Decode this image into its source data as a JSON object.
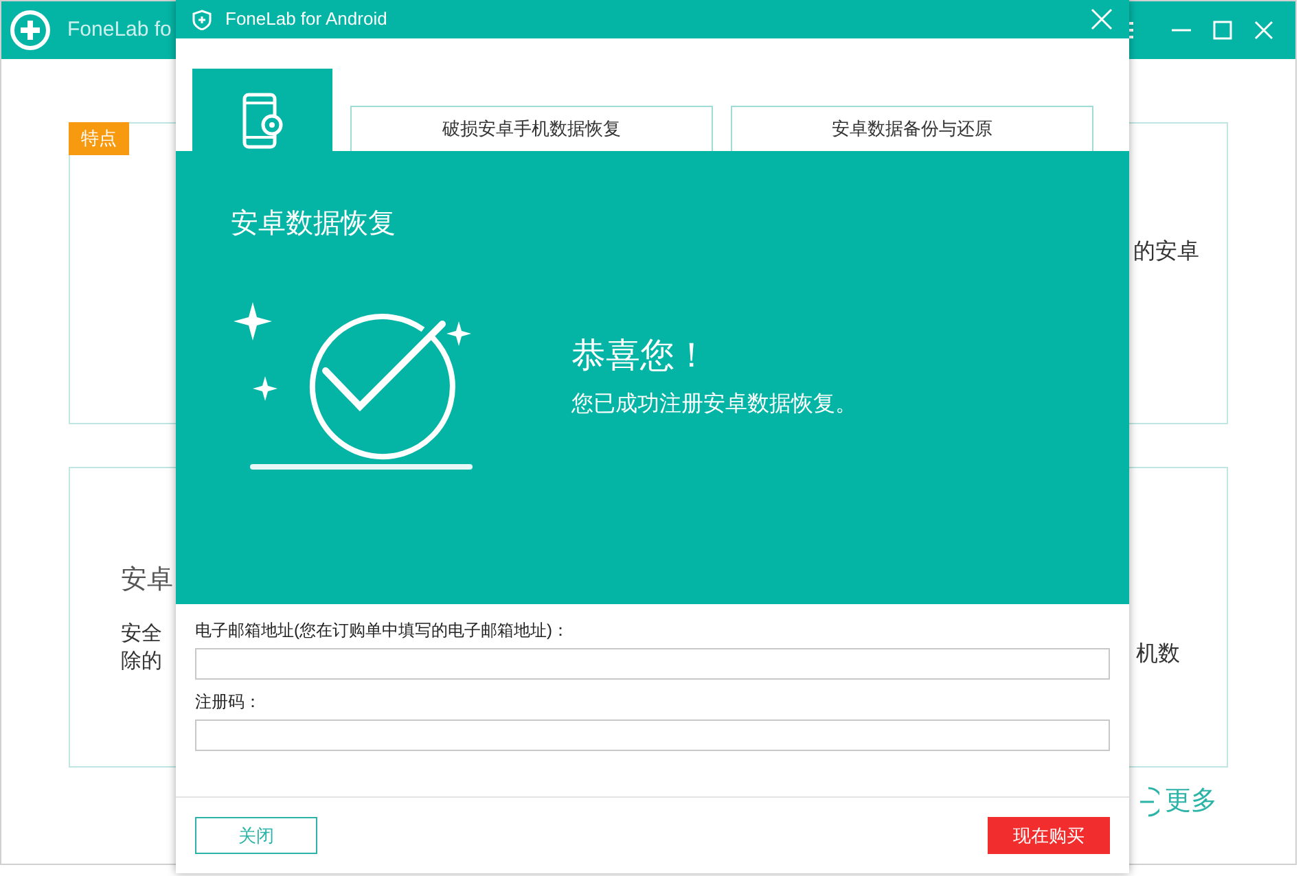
{
  "background_window": {
    "title": "FoneLab fo",
    "badge": "特点",
    "card_1_text": "的安卓",
    "card_2_title": "安卓",
    "card_2_lines": [
      "安全",
      "除的"
    ],
    "card_2_right_text": "机数",
    "more_link": "更多"
  },
  "dialog": {
    "title": "FoneLab for Android",
    "tabs": [
      {
        "kind": "icon",
        "selected": true
      },
      {
        "kind": "text",
        "label": "破损安卓手机数据恢复",
        "selected": false
      },
      {
        "kind": "text",
        "label": "安卓数据备份与还原",
        "selected": false
      }
    ],
    "heading": "安卓数据恢复",
    "message_title": "恭喜您！",
    "message": "您已成功注册安卓数据恢复。",
    "fields": [
      {
        "label": "电子邮箱地址(您在订购单中填写的电子邮箱地址)："
      },
      {
        "label": "注册码："
      }
    ],
    "buttons": [
      {
        "kind": "secondary",
        "label": "关闭"
      },
      {
        "kind": "primary",
        "label": "现在购买"
      }
    ]
  }
}
